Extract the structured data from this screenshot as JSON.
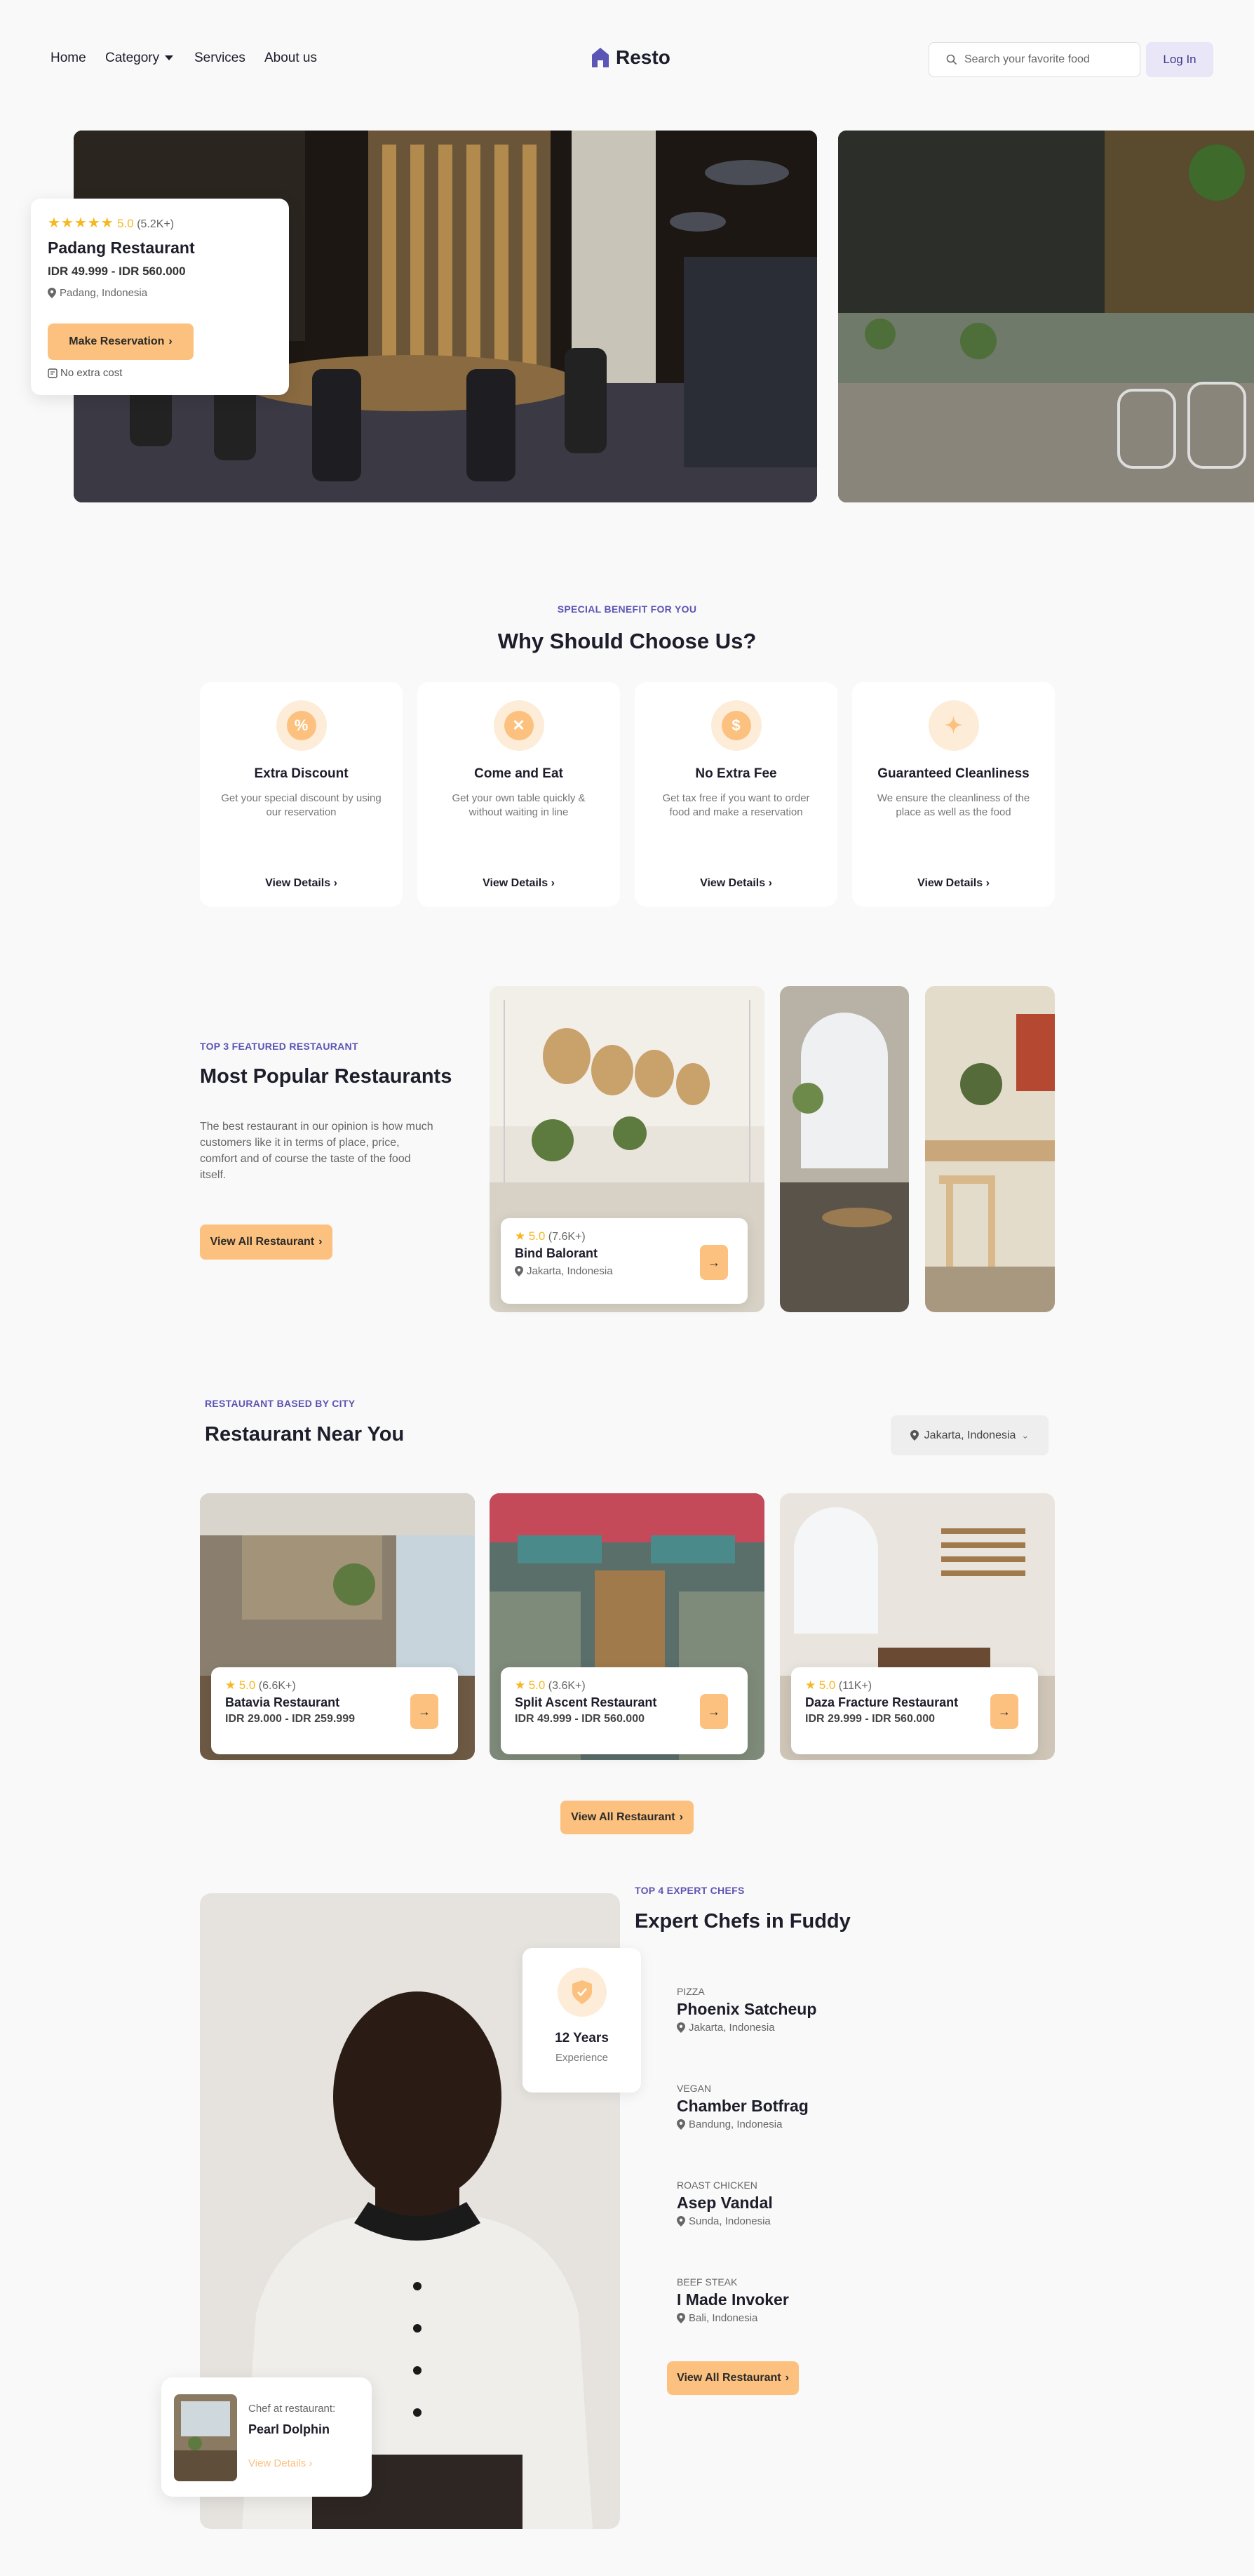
{
  "nav": {
    "links": [
      "Home",
      "Category",
      "Services",
      "About us"
    ],
    "logo_text": "Resto",
    "search_placeholder": "Search your favorite food",
    "login_label": "Log In"
  },
  "hero": {
    "stars": "★★★★★",
    "rating": "5.0",
    "rating_count": "(5.2K+)",
    "name": "Padang Restaurant",
    "price": "IDR 49.999 - IDR 560.000",
    "location": "Padang, Indonesia",
    "button_label": "Make Reservation",
    "note": "No extra cost"
  },
  "benefits": {
    "eyebrow": "SPECIAL BENEFIT FOR YOU",
    "title": "Why Should Choose Us?",
    "items": [
      {
        "title": "Extra Discount",
        "desc": "Get your special discount by using our reservation",
        "link": "View Details",
        "icon": "discount-badge-icon"
      },
      {
        "title": "Come and Eat",
        "desc": "Get your own table quickly & without waiting in line",
        "link": "View Details",
        "icon": "cutlery-icon"
      },
      {
        "title": "No Extra Fee",
        "desc": "Get tax free if you want to order food and make a reservation",
        "link": "View Details",
        "icon": "money-bag-icon"
      },
      {
        "title": "Guaranteed Cleanliness",
        "desc": "We ensure the cleanliness of the place as well as the food",
        "link": "View Details",
        "icon": "sparkle-icon"
      }
    ]
  },
  "popular": {
    "eyebrow": "TOP 3 FEATURED RESTAURANT",
    "title": "Most Popular Restaurants",
    "desc": "The best restaurant in our opinion is how much customers like it in terms of place, price, comfort and of course the taste of the food itself.",
    "button_label": "View All Restaurant",
    "featured": {
      "rating": "5.0",
      "count": "(7.6K+)",
      "name": "Bind Balorant",
      "location": "Jakarta, Indonesia"
    }
  },
  "city": {
    "eyebrow": "RESTAURANT BASED BY CITY",
    "title": "Restaurant Near You",
    "selected_city": "Jakarta, Indonesia",
    "button_label": "View All Restaurant",
    "items": [
      {
        "rating": "5.0",
        "count": "(6.6K+)",
        "name": "Batavia Restaurant",
        "price": "IDR 29.000 - IDR 259.999"
      },
      {
        "rating": "5.0",
        "count": "(3.6K+)",
        "name": "Split Ascent Restaurant",
        "price": "IDR 49.999 - IDR 560.000"
      },
      {
        "rating": "5.0",
        "count": "(11K+)",
        "name": "Daza Fracture Restaurant",
        "price": "IDR 29.999 - IDR 560.000"
      }
    ]
  },
  "chefs": {
    "eyebrow": "TOP 4 EXPERT CHEFS",
    "title": "Expert Chefs in Fuddy",
    "experience_value": "12 Years",
    "experience_label": "Experience",
    "list": [
      {
        "category": "PIZZA",
        "name": "Phoenix Satcheup",
        "location": "Jakarta, Indonesia"
      },
      {
        "category": "VEGAN",
        "name": "Chamber Botfrag",
        "location": "Bandung, Indonesia"
      },
      {
        "category": "ROAST CHICKEN",
        "name": "Asep Vandal",
        "location": "Sunda, Indonesia"
      },
      {
        "category": "BEEF STEAK",
        "name": "I Made Invoker",
        "location": "Bali, Indonesia"
      }
    ],
    "button_label": "View All Restaurant",
    "card": {
      "label": "Chef at restaurant:",
      "name": "Pearl Dolphin",
      "link": "View Details"
    }
  },
  "colors": {
    "accent": "#fcc17e",
    "brand": "#5b55b5",
    "star": "#f5b820",
    "background": "#f9f9f9"
  }
}
